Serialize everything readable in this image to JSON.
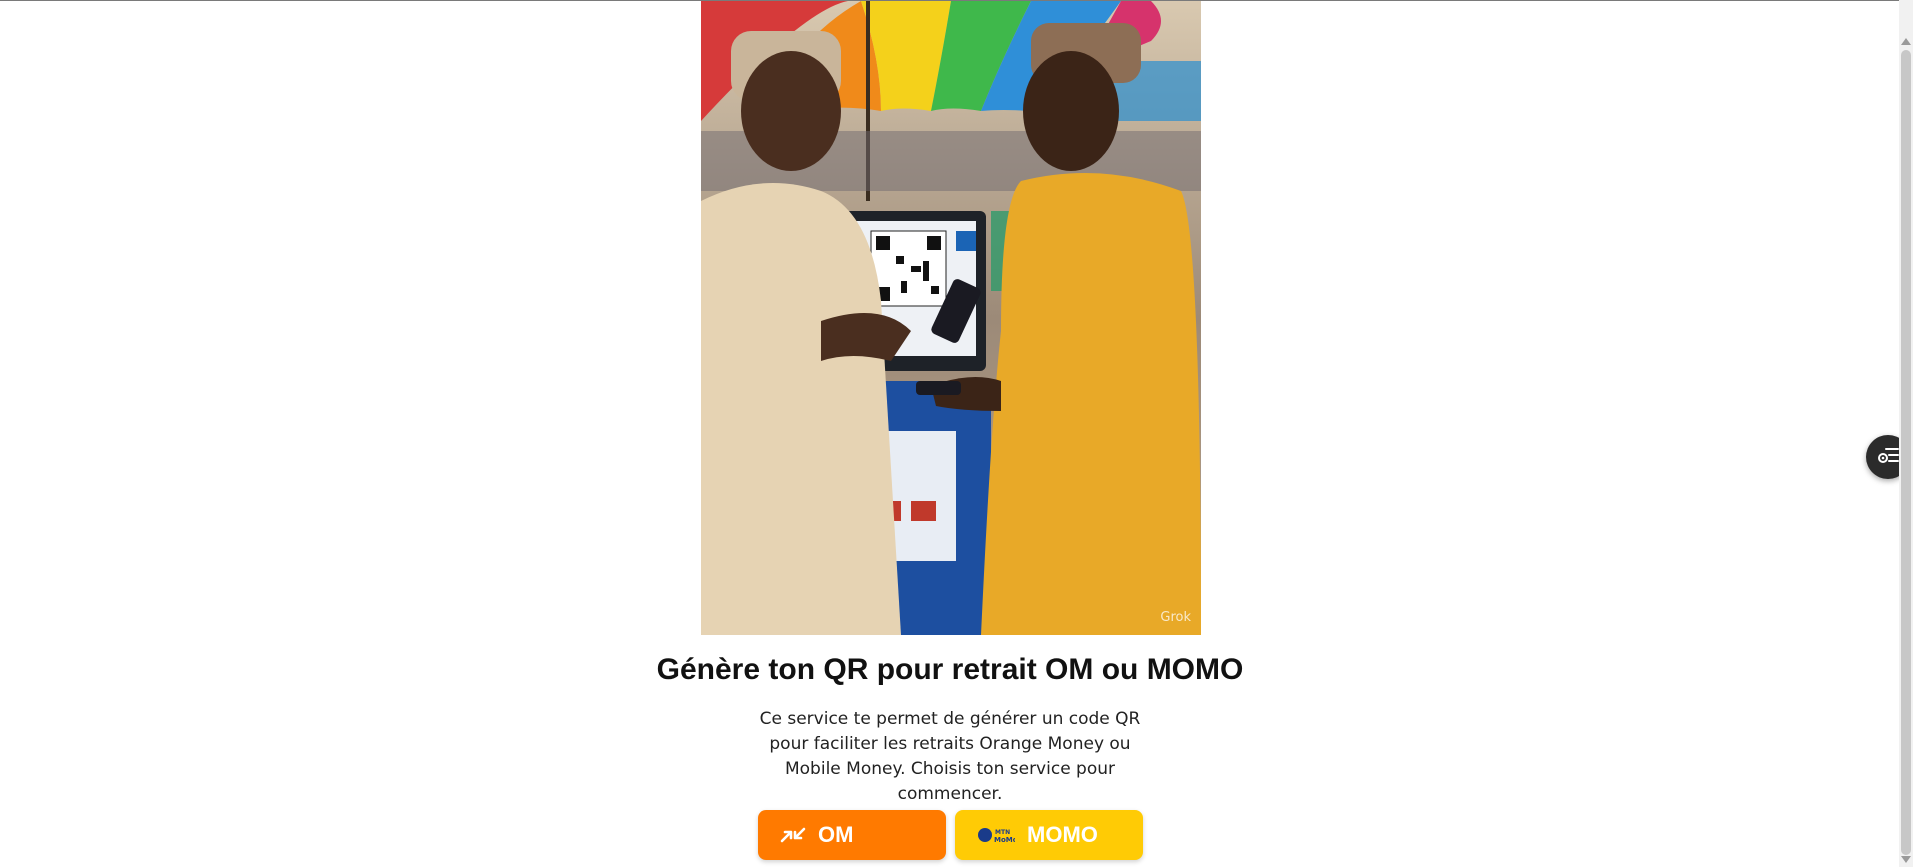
{
  "hero": {
    "image_icon": "photo-two-men-qr-kiosk",
    "watermark": "Grok"
  },
  "main": {
    "title": "Génère ton QR pour retrait OM ou MOMO",
    "description": "Ce service te permet de générer un code QR pour faciliter les retraits Orange Money ou Mobile Money. Choisis ton service pour commencer."
  },
  "buttons": {
    "om": {
      "label": "OM",
      "icon": "orange-money-icon",
      "color": "#ff7a00"
    },
    "momo": {
      "label": "MOMO",
      "icon": "mtn-momo-icon",
      "color": "#ffcb05"
    }
  },
  "floating": {
    "icon": "list-settings-icon"
  }
}
